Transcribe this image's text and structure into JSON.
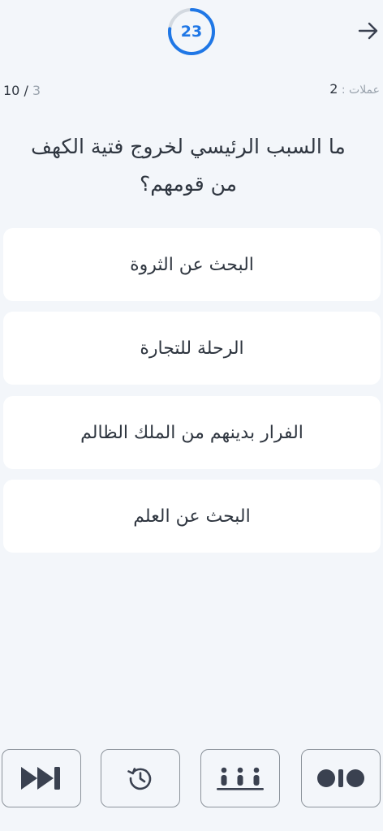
{
  "timer": {
    "seconds": "23",
    "fraction_remaining": 0.77
  },
  "progress": {
    "total": "10",
    "separator": " / ",
    "answered": "3"
  },
  "coins": {
    "label": "عملات",
    "separator": " : ",
    "value": "2"
  },
  "question": {
    "text": "ما السبب الرئيسي لخروج فتية الكهف من قومهم؟"
  },
  "answers": [
    {
      "label": "البحث عن الثروة"
    },
    {
      "label": "الرحلة للتجارة"
    },
    {
      "label": "الفرار بدينهم من الملك الظالم"
    },
    {
      "label": "البحث عن العلم"
    }
  ],
  "toolbar": [
    {
      "icon": "skip-forward-icon"
    },
    {
      "icon": "history-icon"
    },
    {
      "icon": "audience-icon"
    },
    {
      "icon": "fifty-fifty-icon"
    }
  ],
  "colors": {
    "accent": "#1f77e6",
    "timer_track": "#d3d9e0",
    "background": "#f3f6fa",
    "card": "#ffffff",
    "icon_dark": "#3a4150"
  }
}
